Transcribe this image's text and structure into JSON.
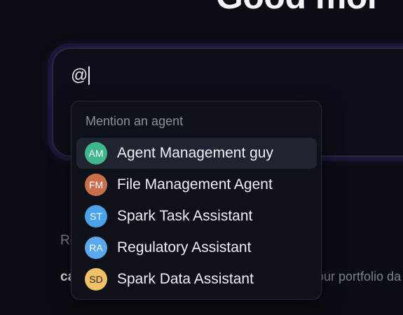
{
  "header": {
    "greeting": "Good mor"
  },
  "composer": {
    "value": "@"
  },
  "background_text": {
    "fragment_1": "Re",
    "fragment_2": "ca",
    "fragment_3": "our portfolio da"
  },
  "mention_menu": {
    "title": "Mention an agent",
    "selected_index": 0,
    "items": [
      {
        "initials": "AM",
        "label": "Agent Management guy",
        "avatar_color": "#3fb68b",
        "text_color": "#ffffff"
      },
      {
        "initials": "FM",
        "label": "File Management Agent",
        "avatar_color": "#c96f4e",
        "text_color": "#ffffff"
      },
      {
        "initials": "ST",
        "label": "Spark Task Assistant",
        "avatar_color": "#4aa3e8",
        "text_color": "#ffffff"
      },
      {
        "initials": "RA",
        "label": "Regulatory Assistant",
        "avatar_color": "#5aa8ee",
        "text_color": "#ffffff"
      },
      {
        "initials": "SD",
        "label": "Spark Data Assistant",
        "avatar_color": "#f2c067",
        "text_color": "#2a2a2a"
      }
    ]
  }
}
